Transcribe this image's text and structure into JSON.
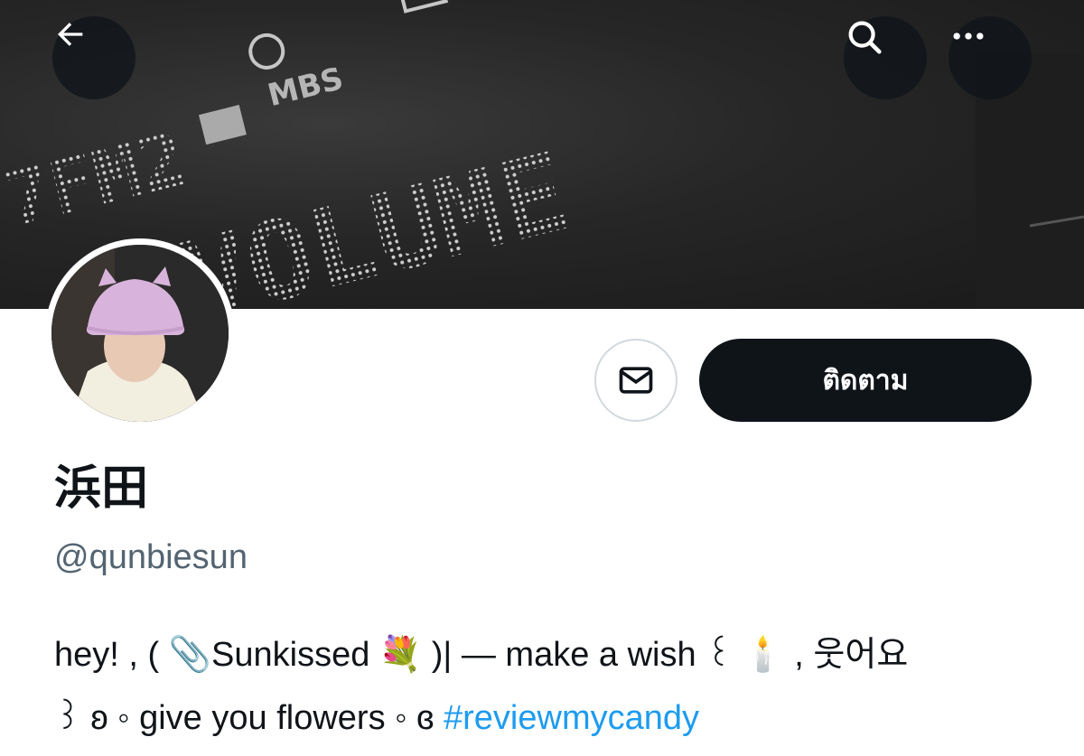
{
  "header": {
    "back_icon": "arrow-left-icon",
    "search_icon": "search-icon",
    "more_icon": "more-horizontal-icon"
  },
  "banner": {
    "text_top": "7FM2",
    "text_main": "VOLUME"
  },
  "profile": {
    "display_name": "浜田",
    "handle": "@qunbiesun",
    "follow_label": "ติดตาม",
    "message_icon": "envelope-icon"
  },
  "bio": {
    "line1": "hey! , ( 📎Sunkissed 💐 )|   — make a wish ꒰ 🕯️ , 웃어요",
    "line2_text": "꒱ ʚ ◦ give you flowers ◦ ɞ ",
    "hashtag": "#reviewmycandy"
  },
  "colors": {
    "accent": "#1d9bf0",
    "button_dark": "#0f1419",
    "secondary_text": "#536471",
    "border": "#cfd9de"
  }
}
